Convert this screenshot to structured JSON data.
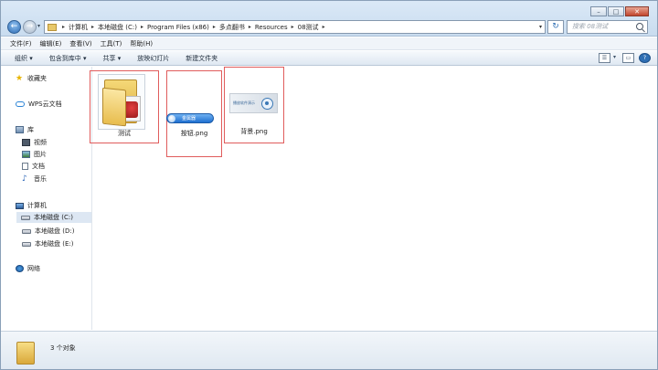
{
  "window": {
    "min_glyph": "–",
    "max_glyph": "□",
    "close_glyph": "✕"
  },
  "nav": {
    "back_glyph": "←",
    "forward_glyph": "→",
    "dropdown_glyph": "▾"
  },
  "address": {
    "crumbs": [
      "计算机",
      "本地磁盘 (C:)",
      "Program Files (x86)",
      "多点翻书",
      "Resources",
      "08测试"
    ],
    "separator": "▸",
    "dropdown_glyph": "▾",
    "refresh_glyph": "↻"
  },
  "search": {
    "placeholder": "搜索 08测试"
  },
  "menu": {
    "items": [
      "文件(F)",
      "编辑(E)",
      "查看(V)",
      "工具(T)",
      "帮助(H)"
    ]
  },
  "toolbar": {
    "buttons": [
      "组织 ▾",
      "包含到库中 ▾",
      "共享 ▾",
      "放映幻灯片",
      "新建文件夹"
    ],
    "view_glyph": "☰",
    "view_dropdown_glyph": "▾",
    "preview_glyph": "▭",
    "help_glyph": "?"
  },
  "sidebar": {
    "favorites": "收藏夹",
    "wps_cloud": "WPS云文档",
    "libraries": "库",
    "library_items": [
      "视频",
      "图片",
      "文档",
      "音乐"
    ],
    "computer": "计算机",
    "drives": [
      "本地磁盘 (C:)",
      "本地磁盘 (D:)",
      "本地磁盘 (E:)"
    ],
    "selected_drive_index": 0,
    "network": "网络"
  },
  "files": [
    {
      "name": "测试",
      "kind": "folder"
    },
    {
      "name": "按钮.png",
      "kind": "image",
      "thumb_text": "金属器"
    },
    {
      "name": "背景.png",
      "kind": "image",
      "thumb_text": "播放软件演示"
    }
  ],
  "status": {
    "text": "3 个对象"
  },
  "colors": {
    "selection_box": "#e05c5c",
    "chrome": "#dbe9f7"
  }
}
